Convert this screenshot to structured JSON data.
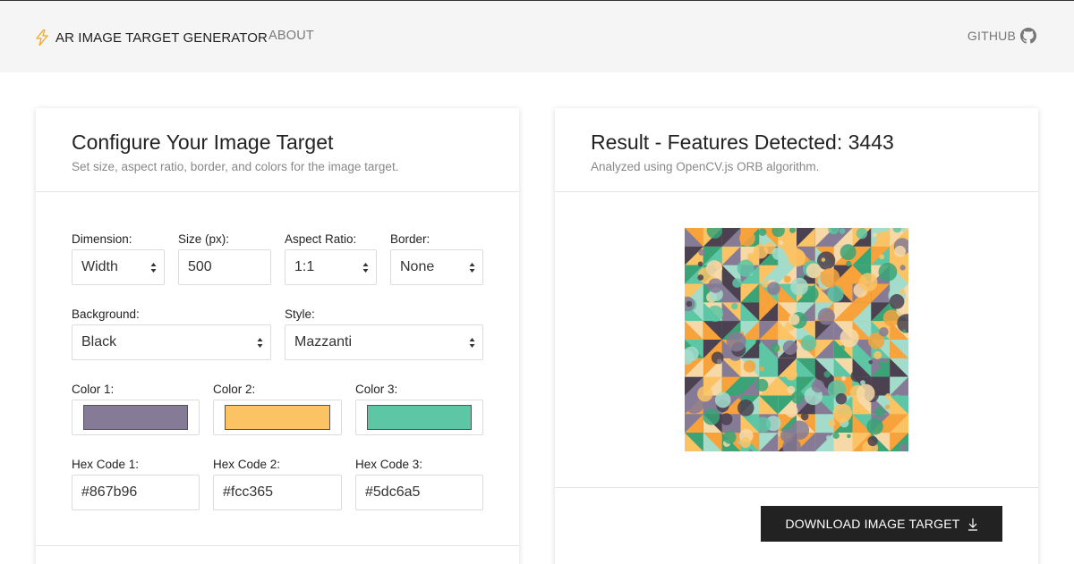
{
  "nav": {
    "brand": "AR IMAGE TARGET GENERATOR",
    "about": "ABOUT",
    "github": "GITHUB",
    "brand_icon": "lightning-bolt-icon",
    "github_icon": "github-icon",
    "bolt_color": "#f5a623"
  },
  "config": {
    "title": "Configure Your Image Target",
    "subtitle": "Set size, aspect ratio, border, and colors for the image target.",
    "dimension": {
      "label": "Dimension:",
      "value": "Width"
    },
    "size": {
      "label": "Size (px):",
      "value": "500"
    },
    "aspect": {
      "label": "Aspect Ratio:",
      "value": "1:1"
    },
    "border": {
      "label": "Border:",
      "value": "None"
    },
    "background": {
      "label": "Background:",
      "value": "Black"
    },
    "style": {
      "label": "Style:",
      "value": "Mazzanti"
    },
    "colors": [
      {
        "label": "Color 1:",
        "hex_label": "Hex Code 1:",
        "hex": "#867b96"
      },
      {
        "label": "Color 2:",
        "hex_label": "Hex Code 2:",
        "hex": "#fcc365"
      },
      {
        "label": "Color 3:",
        "hex_label": "Hex Code 3:",
        "hex": "#5dc6a5"
      }
    ]
  },
  "result": {
    "title": "Result - Features Detected: 3443",
    "subtitle": "Analyzed using OpenCV.js ORB algorithm.",
    "download": "DOWNLOAD IMAGE TARGET",
    "download_icon": "download-arrow-icon",
    "pattern_palette": [
      "#867b96",
      "#fcc365",
      "#5dc6a5",
      "#f7a23b",
      "#4b4150",
      "#a3dccb",
      "#3aa477",
      "#f7d9a8"
    ]
  }
}
